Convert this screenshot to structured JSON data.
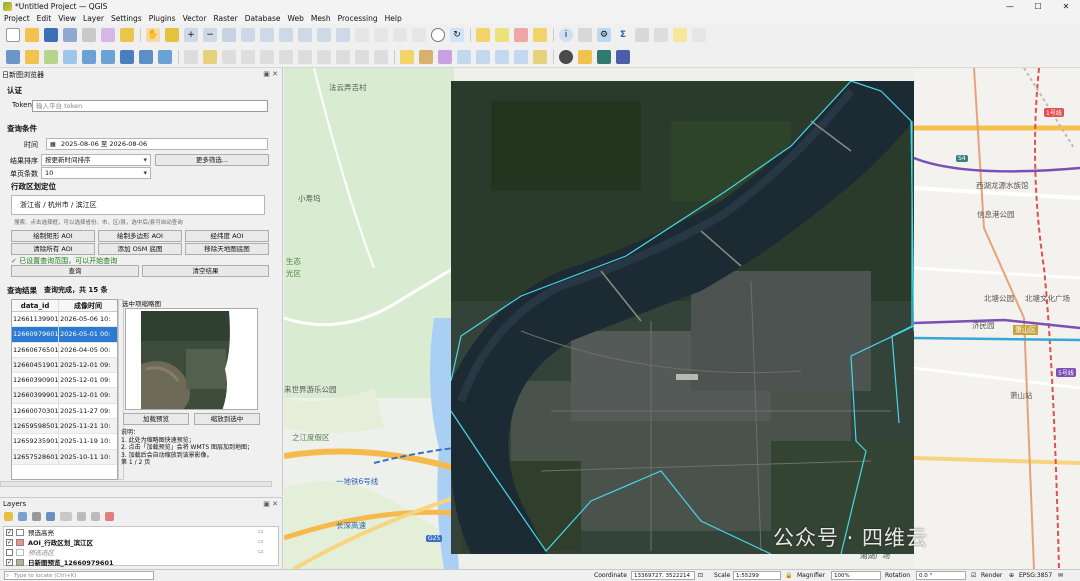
{
  "window": {
    "title": "*Untitled Project — QGIS"
  },
  "menu": [
    "Project",
    "Edit",
    "View",
    "Layer",
    "Settings",
    "Plugins",
    "Vector",
    "Raster",
    "Database",
    "Web",
    "Mesh",
    "Processing",
    "Help"
  ],
  "panel": {
    "title": "日新图浏览器",
    "auth": {
      "section": "认证",
      "token_label": "Token",
      "token_placeholder": "输入平台 token"
    },
    "query": {
      "section": "查询条件",
      "time_label": "时间",
      "time_value": "2025-08-06 至 2026-08-06",
      "sort_label": "结果排序",
      "sort_value": "按更新时间排序",
      "more_filter": "更多筛选...",
      "page_label": "单页条数",
      "page_value": "10"
    },
    "region": {
      "section": "行政区划定位",
      "value": "浙江省 / 杭州市 / 滨江区",
      "hint": "搜索、点击选择框，可以选择省份、市、区/县，选中后/县可自动查询"
    },
    "buttons": {
      "draw_rect": "绘制矩形 AOI",
      "draw_poly": "绘制多边形 AOI",
      "latlon": "经纬度 AOI",
      "clear": "清除所有 AOI",
      "add_osm": "添加 OSM 底图",
      "remove_map": "移除天地图底图",
      "query": "查询",
      "clear_result": "清空结果"
    },
    "status_ok": "✓ 已设置查询范围，可以开始查询",
    "results": {
      "section": "查询结果",
      "summary": "查询完成，共 15 条",
      "columns": [
        "data_id",
        "成像时间"
      ],
      "rows": [
        {
          "id": "12661139901",
          "time": "2026-05-06 10:"
        },
        {
          "id": "12660979601",
          "time": "2026-05-01 00:"
        },
        {
          "id": "12660676501",
          "time": "2026-04-05 00:"
        },
        {
          "id": "12660451901",
          "time": "2025-12-01 09:"
        },
        {
          "id": "12660390901",
          "time": "2025-12-01 09:"
        },
        {
          "id": "12660399901",
          "time": "2025-12-01 09:"
        },
        {
          "id": "12660070301",
          "time": "2025-11-27 09:"
        },
        {
          "id": "12659598501",
          "time": "2025-11-21 10:"
        },
        {
          "id": "12659235901",
          "time": "2025-11-19 10:"
        },
        {
          "id": "12657528601",
          "time": "2025-10-11 10:"
        }
      ]
    },
    "preview": {
      "title": "选中项缩略图",
      "load_preview": "加载预览",
      "zoom_to": "缩放到选中",
      "notes": [
        "说明：",
        "1. 此处为缩略图快速预览；",
        "2. 点击「加载预览」会将 WMTS 图层加到地图；",
        "3. 加载后会自动缩放到该景影像。"
      ],
      "pages": "第 1 / 2 页"
    }
  },
  "layers": {
    "title": "Layers",
    "items": [
      {
        "name": "预选高亮"
      },
      {
        "name": "AOI_行政区划_滨江区",
        "color": "#f28f8f"
      },
      {
        "name": "预选选区"
      },
      {
        "name": "日新图预览_12660979601"
      }
    ]
  },
  "map": {
    "labels": [
      "法云弄吉村",
      "小寿坞",
      "生态",
      "光区",
      "来世界游乐公园",
      "西湖龙源水族馆",
      "信息港公园",
      "北塘公园",
      "北塘文化广场",
      "济民园",
      "萧山区",
      "萧山站",
      "湘湖广场",
      "之江度假区",
      "一地铁6号线",
      "长深高速",
      "G25"
    ],
    "metro": [
      "S4",
      "1号线",
      "5号线"
    ]
  },
  "statusbar": {
    "search_placeholder": "Type to locate (Ctrl+K)",
    "coordinate_label": "Coordinate",
    "coordinate": "13369727, 3522214",
    "scale_label": "Scale",
    "scale": "1:55299",
    "magnifier_label": "Magnifier",
    "magnifier": "100%",
    "rotation_label": "Rotation",
    "rotation": "0.0 °",
    "render": "Render",
    "crs": "EPSG:3857"
  },
  "watermark": "公众号 · 四维云"
}
